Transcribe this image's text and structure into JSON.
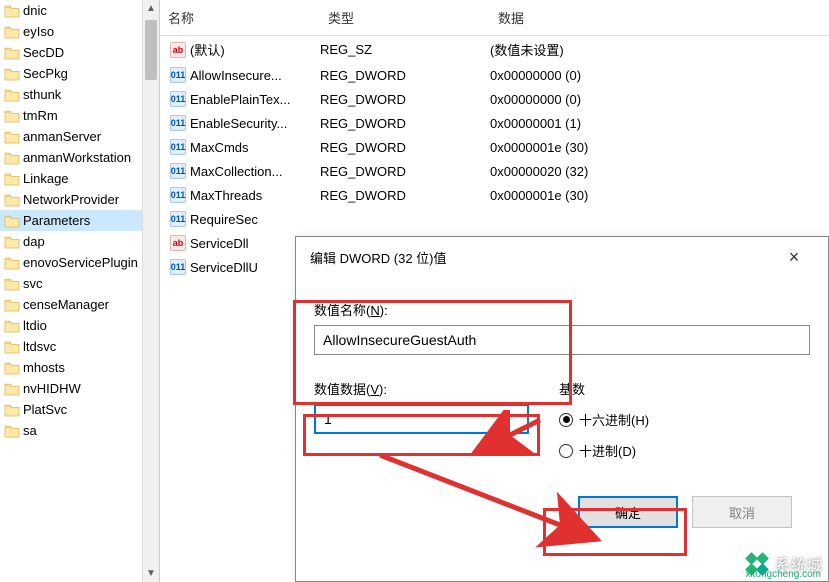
{
  "tree": {
    "items": [
      {
        "label": "dnic"
      },
      {
        "label": "eyIso"
      },
      {
        "label": "SecDD"
      },
      {
        "label": "SecPkg"
      },
      {
        "label": "sthunk"
      },
      {
        "label": "tmRm"
      },
      {
        "label": "anmanServer"
      },
      {
        "label": "anmanWorkstation"
      },
      {
        "label": "Linkage"
      },
      {
        "label": "NetworkProvider"
      },
      {
        "label": "Parameters",
        "selected": true
      },
      {
        "label": "dap"
      },
      {
        "label": "enovoServicePlugin"
      },
      {
        "label": "svc"
      },
      {
        "label": "censeManager"
      },
      {
        "label": "ltdio"
      },
      {
        "label": "ltdsvc"
      },
      {
        "label": "mhosts"
      },
      {
        "label": "nvHIDHW"
      },
      {
        "label": "PlatSvc"
      },
      {
        "label": "sa"
      }
    ]
  },
  "list": {
    "headers": {
      "name": "名称",
      "type": "类型",
      "data": "数据"
    },
    "rows": [
      {
        "icon": "str",
        "name": "(默认)",
        "type": "REG_SZ",
        "data": "(数值未设置)"
      },
      {
        "icon": "dw",
        "name": "AllowInsecure...",
        "type": "REG_DWORD",
        "data": "0x00000000 (0)"
      },
      {
        "icon": "dw",
        "name": "EnablePlainTex...",
        "type": "REG_DWORD",
        "data": "0x00000000 (0)"
      },
      {
        "icon": "dw",
        "name": "EnableSecurity...",
        "type": "REG_DWORD",
        "data": "0x00000001 (1)"
      },
      {
        "icon": "dw",
        "name": "MaxCmds",
        "type": "REG_DWORD",
        "data": "0x0000001e (30)"
      },
      {
        "icon": "dw",
        "name": "MaxCollection...",
        "type": "REG_DWORD",
        "data": "0x00000020 (32)"
      },
      {
        "icon": "dw",
        "name": "MaxThreads",
        "type": "REG_DWORD",
        "data": "0x0000001e (30)"
      },
      {
        "icon": "dw",
        "name": "RequireSec",
        "type": "",
        "data": ""
      },
      {
        "icon": "str",
        "name": "ServiceDll",
        "type": "",
        "data": ""
      },
      {
        "icon": "dw",
        "name": "ServiceDllU",
        "type": "",
        "data": ""
      }
    ]
  },
  "dialog": {
    "title": "编辑 DWORD (32 位)值",
    "nameLabel": "数值名称(",
    "nameKey": "N",
    "nameLabelEnd": "):",
    "nameValue": "AllowInsecureGuestAuth",
    "dataLabel": "数值数据(",
    "dataKey": "V",
    "dataLabelEnd": "):",
    "dataValue": "1",
    "baseLabel": "基数",
    "hex": "十六进制(",
    "hexKey": "H",
    "hexEnd": ")",
    "dec": "十进制(",
    "decKey": "D",
    "decEnd": ")",
    "ok": "确定",
    "cancel": "取消"
  },
  "watermark": {
    "text": "系统城",
    "url": "xitongcheng.com"
  }
}
